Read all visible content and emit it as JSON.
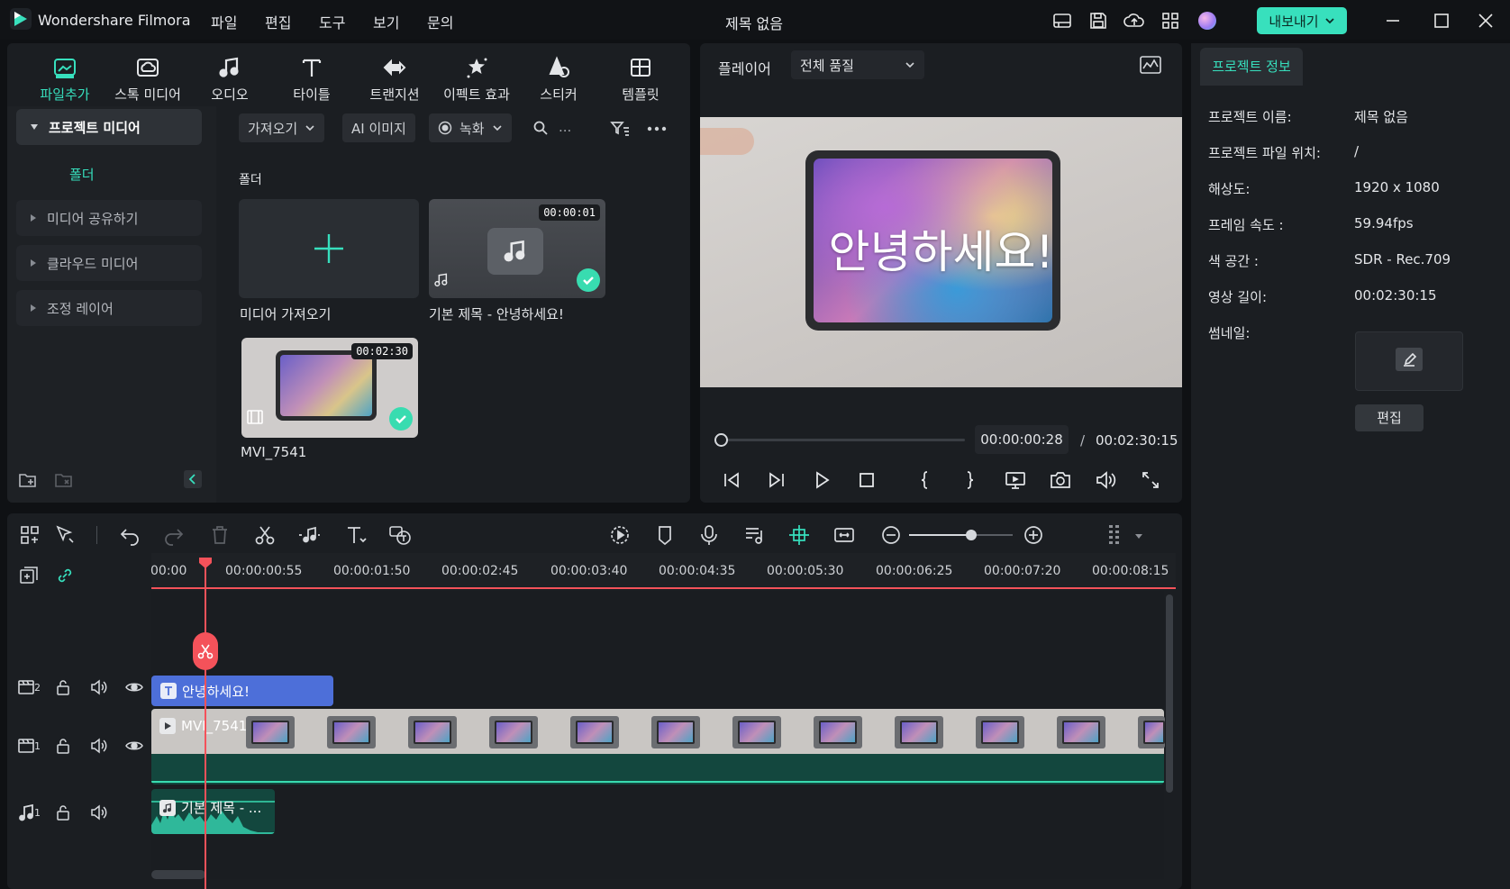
{
  "app": {
    "name": "Wondershare Filmora",
    "document_title": "제목 없음"
  },
  "menu": [
    "파일",
    "편집",
    "도구",
    "보기",
    "문의"
  ],
  "export_label": "내보내기",
  "toolbar_tabs": [
    {
      "label": "파일추가",
      "icon": "media-icon",
      "active": true
    },
    {
      "label": "스톡 미디어",
      "icon": "stock-media-icon",
      "active": false
    },
    {
      "label": "오디오",
      "icon": "music-note-icon",
      "active": false
    },
    {
      "label": "타이틀",
      "icon": "title-t-icon",
      "active": false
    },
    {
      "label": "트랜지션",
      "icon": "transition-icon",
      "active": false
    },
    {
      "label": "이펙트 효과",
      "icon": "effects-sparkle-icon",
      "active": false
    },
    {
      "label": "스티커",
      "icon": "sticker-icon",
      "active": false
    },
    {
      "label": "템플릿",
      "icon": "template-icon",
      "active": false
    }
  ],
  "sidebar": {
    "items": [
      "프로젝트 미디어",
      "폴더",
      "미디어 공유하기",
      "클라우드 미디어",
      "조정 레이어"
    ]
  },
  "media_toolbar": {
    "import": "가져오기",
    "ai_image": "AI 이미지",
    "record": "녹화",
    "search_placeholder": "..."
  },
  "media": {
    "section_title": "폴더",
    "import_card_label": "미디어 가져오기",
    "items": [
      {
        "label": "기본 제목 - 안녕하세요!",
        "duration": "00:00:01"
      },
      {
        "label": "MVI_7541",
        "duration": "00:02:30"
      }
    ]
  },
  "player": {
    "label": "플레이어",
    "quality": "전체 품질",
    "overlay_text": "안녕하세요!",
    "current_time": "00:00:00:28",
    "separator": "/",
    "total_time": "00:02:30:15",
    "progress": 0.0
  },
  "info": {
    "tab": "프로젝트 정보",
    "rows": [
      {
        "label": "프로젝트 이름:",
        "value": "제목 없음"
      },
      {
        "label": "프로젝트 파일 위치:",
        "value": "/"
      },
      {
        "label": "해상도:",
        "value": "1920 x 1080"
      },
      {
        "label": "프레임 속도 :",
        "value": "59.94fps"
      },
      {
        "label": "색 공간 :",
        "value": "SDR - Rec.709"
      },
      {
        "label": "영상 길이:",
        "value": "00:02:30:15"
      }
    ],
    "thumbnail_label": "썸네일:",
    "edit_button": "편집"
  },
  "timeline": {
    "ruler": [
      "00:00",
      "00:00:00:55",
      "00:00:01:50",
      "00:00:02:45",
      "00:00:03:40",
      "00:00:04:35",
      "00:00:05:30",
      "00:00:06:25",
      "00:00:07:20",
      "00:00:08:15"
    ],
    "tracks": [
      {
        "id": "2",
        "clip": "안녕하세요!"
      },
      {
        "id": "1",
        "clip": "MVI_7541"
      },
      {
        "id": "1",
        "clip": "기본 제목 - ..."
      }
    ],
    "zoom_level": 0.6
  },
  "colors": {
    "accent": "#38e0bd",
    "playhead": "#f4525a",
    "title_clip": "#4d6fd9",
    "video_track": "#13473e"
  }
}
